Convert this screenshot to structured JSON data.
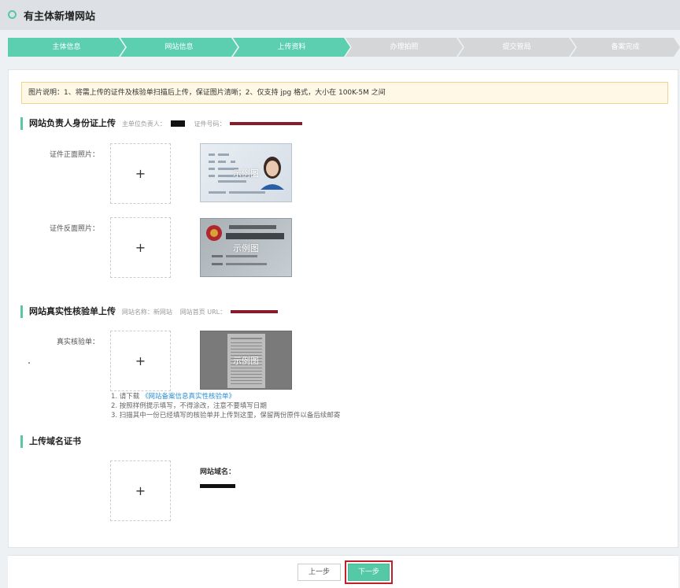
{
  "page": {
    "title": "有主体新增网站"
  },
  "steps": [
    {
      "label": "主体信息",
      "state": "active"
    },
    {
      "label": "网站信息",
      "state": "active"
    },
    {
      "label": "上传资料",
      "state": "active"
    },
    {
      "label": "办理拍照",
      "state": "inactive"
    },
    {
      "label": "提交管局",
      "state": "inactive"
    },
    {
      "label": "备案完成",
      "state": "inactive"
    }
  ],
  "notice": "图片说明：1、将需上传的证件及核验单扫描后上传，保证图片清晰；2、仅支持 jpg 格式，大小在 100K-5M 之间",
  "id_section": {
    "heading": "网站负责人身份证上传",
    "owner_label": "主单位负责人：",
    "id_label": "证件号码：",
    "front_label": "证件正面照片：",
    "back_label": "证件反面照片："
  },
  "verify_section": {
    "heading": "网站真实性核验单上传",
    "site_name": "网站名称：新网站",
    "url_label": "网站首页 URL：",
    "field_label": "真实核验单：",
    "hints": {
      "line1_prefix": "1. 请下载",
      "line1_link": "《网站备案信息真实性核验单》",
      "line2": "2. 按照样例提示填写，不得涂改，注意不要填写日期",
      "line3": "3. 扫描其中一份已经填写的核验单并上传到这里，保留两份原件以备后续邮寄"
    }
  },
  "domain_section": {
    "heading": "上传域名证书",
    "domain_label": "网站域名："
  },
  "sample_caption": "示例图",
  "upload_plus": "+",
  "buttons": {
    "prev": "上一步",
    "next": "下一步"
  },
  "colors": {
    "accent": "#5bcfb0",
    "inactive_step": "#d4d6d8",
    "highlight_border": "#c0202a",
    "link": "#2b8fd6"
  }
}
